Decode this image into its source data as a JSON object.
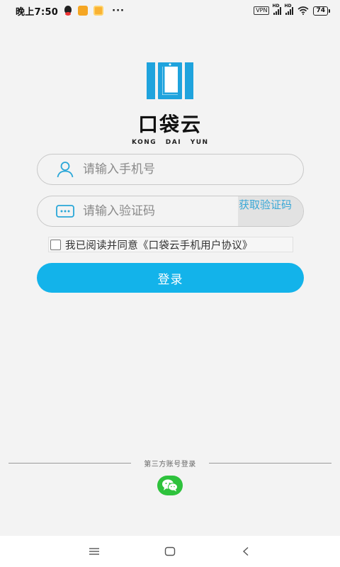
{
  "status_bar": {
    "time": "晚上7:50",
    "more": "···",
    "vpn": "VPN",
    "signal_hd": "HD",
    "battery": "74"
  },
  "logo": {
    "name": "口袋云",
    "pinyin": "KONG DAI YUN"
  },
  "login_form": {
    "phone_placeholder": "请输入手机号",
    "code_placeholder": "请输入验证码",
    "get_code_label": "获取验证码",
    "agreement_text": "我已阅读并同意《口袋云手机用户协议》",
    "login_label": "登录"
  },
  "third_party": {
    "label": "第三方账号登录"
  },
  "colors": {
    "accent": "#13b3ea",
    "logo_blue": "#1fa3dd",
    "wechat_green": "#2ec23c",
    "background": "#f3f3f3"
  },
  "icons": {
    "phone_field": "user-icon",
    "code_field": "keyboard-icon",
    "third_party": "wechat-icon",
    "nav": [
      "menu-icon",
      "home-square-icon",
      "back-chevron-icon"
    ]
  }
}
